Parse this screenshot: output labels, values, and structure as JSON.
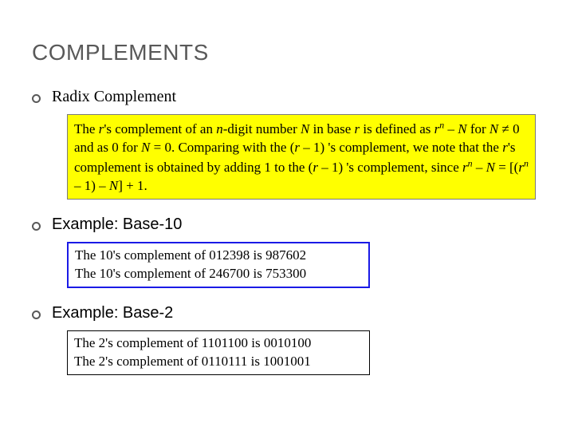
{
  "title": "COMPLEMENTS",
  "sections": [
    {
      "heading": "Radix Complement",
      "font": "serif"
    },
    {
      "heading": "Example: Base-10",
      "font": "sans"
    },
    {
      "heading": "Example: Base-2",
      "font": "sans"
    }
  ],
  "defbox": {
    "t1": "The ",
    "r1": "r",
    "t2": "'s complement of an ",
    "n1": "n",
    "t3": "-digit number ",
    "N1": "N",
    "t4": " in base ",
    "r2": "r",
    "t5": " is defined as ",
    "r3": "r",
    "sup1": "n",
    "t6": " – ",
    "N2": "N",
    "t7": " for ",
    "N3": "N",
    "t8": " ≠ 0 and as 0 for ",
    "N4": "N",
    "t9": " = 0. Comparing with the (",
    "r4": "r",
    "t10": " – 1) 's complement, we note that the ",
    "r5": "r",
    "t11": "'s complement is obtained by adding 1 to the (",
    "r6": "r",
    "t12": " – 1) 's complement, since ",
    "r7": "r",
    "sup2": "n",
    "t13": " – ",
    "N5": "N",
    "t14": " = [(",
    "r8": "r",
    "sup3": "n",
    "t15": " – 1) – ",
    "N6": "N",
    "t16": "] + 1."
  },
  "base10": {
    "line1": "The 10's complement of 012398 is 987602",
    "line2": "The 10's complement of 246700 is 753300"
  },
  "base2": {
    "line1": "The 2's complement of 1101100 is 0010100",
    "line2": "The 2's complement of 0110111 is 1001001"
  }
}
